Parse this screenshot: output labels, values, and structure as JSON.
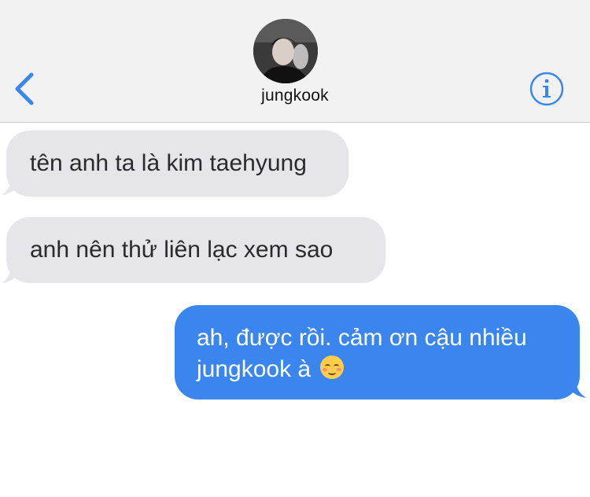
{
  "header": {
    "contact_name": "jungkook",
    "back_icon": "chevron-left-icon",
    "info_icon": "info-icon",
    "accent_color": "#3a86ee"
  },
  "messages": [
    {
      "direction": "incoming",
      "text": "tên anh ta là kim taehyung"
    },
    {
      "direction": "incoming",
      "text": "anh nên thử liên lạc xem sao"
    },
    {
      "direction": "outgoing",
      "line1": "ah, được rồi. cảm ơn cậu nhiều",
      "line2": "jungkook à",
      "emoji": "smiling-face-icon"
    }
  ],
  "colors": {
    "incoming_bubble": "#e5e5ea",
    "outgoing_bubble": "#3a86ee",
    "header_bg": "#f2f2f2"
  }
}
